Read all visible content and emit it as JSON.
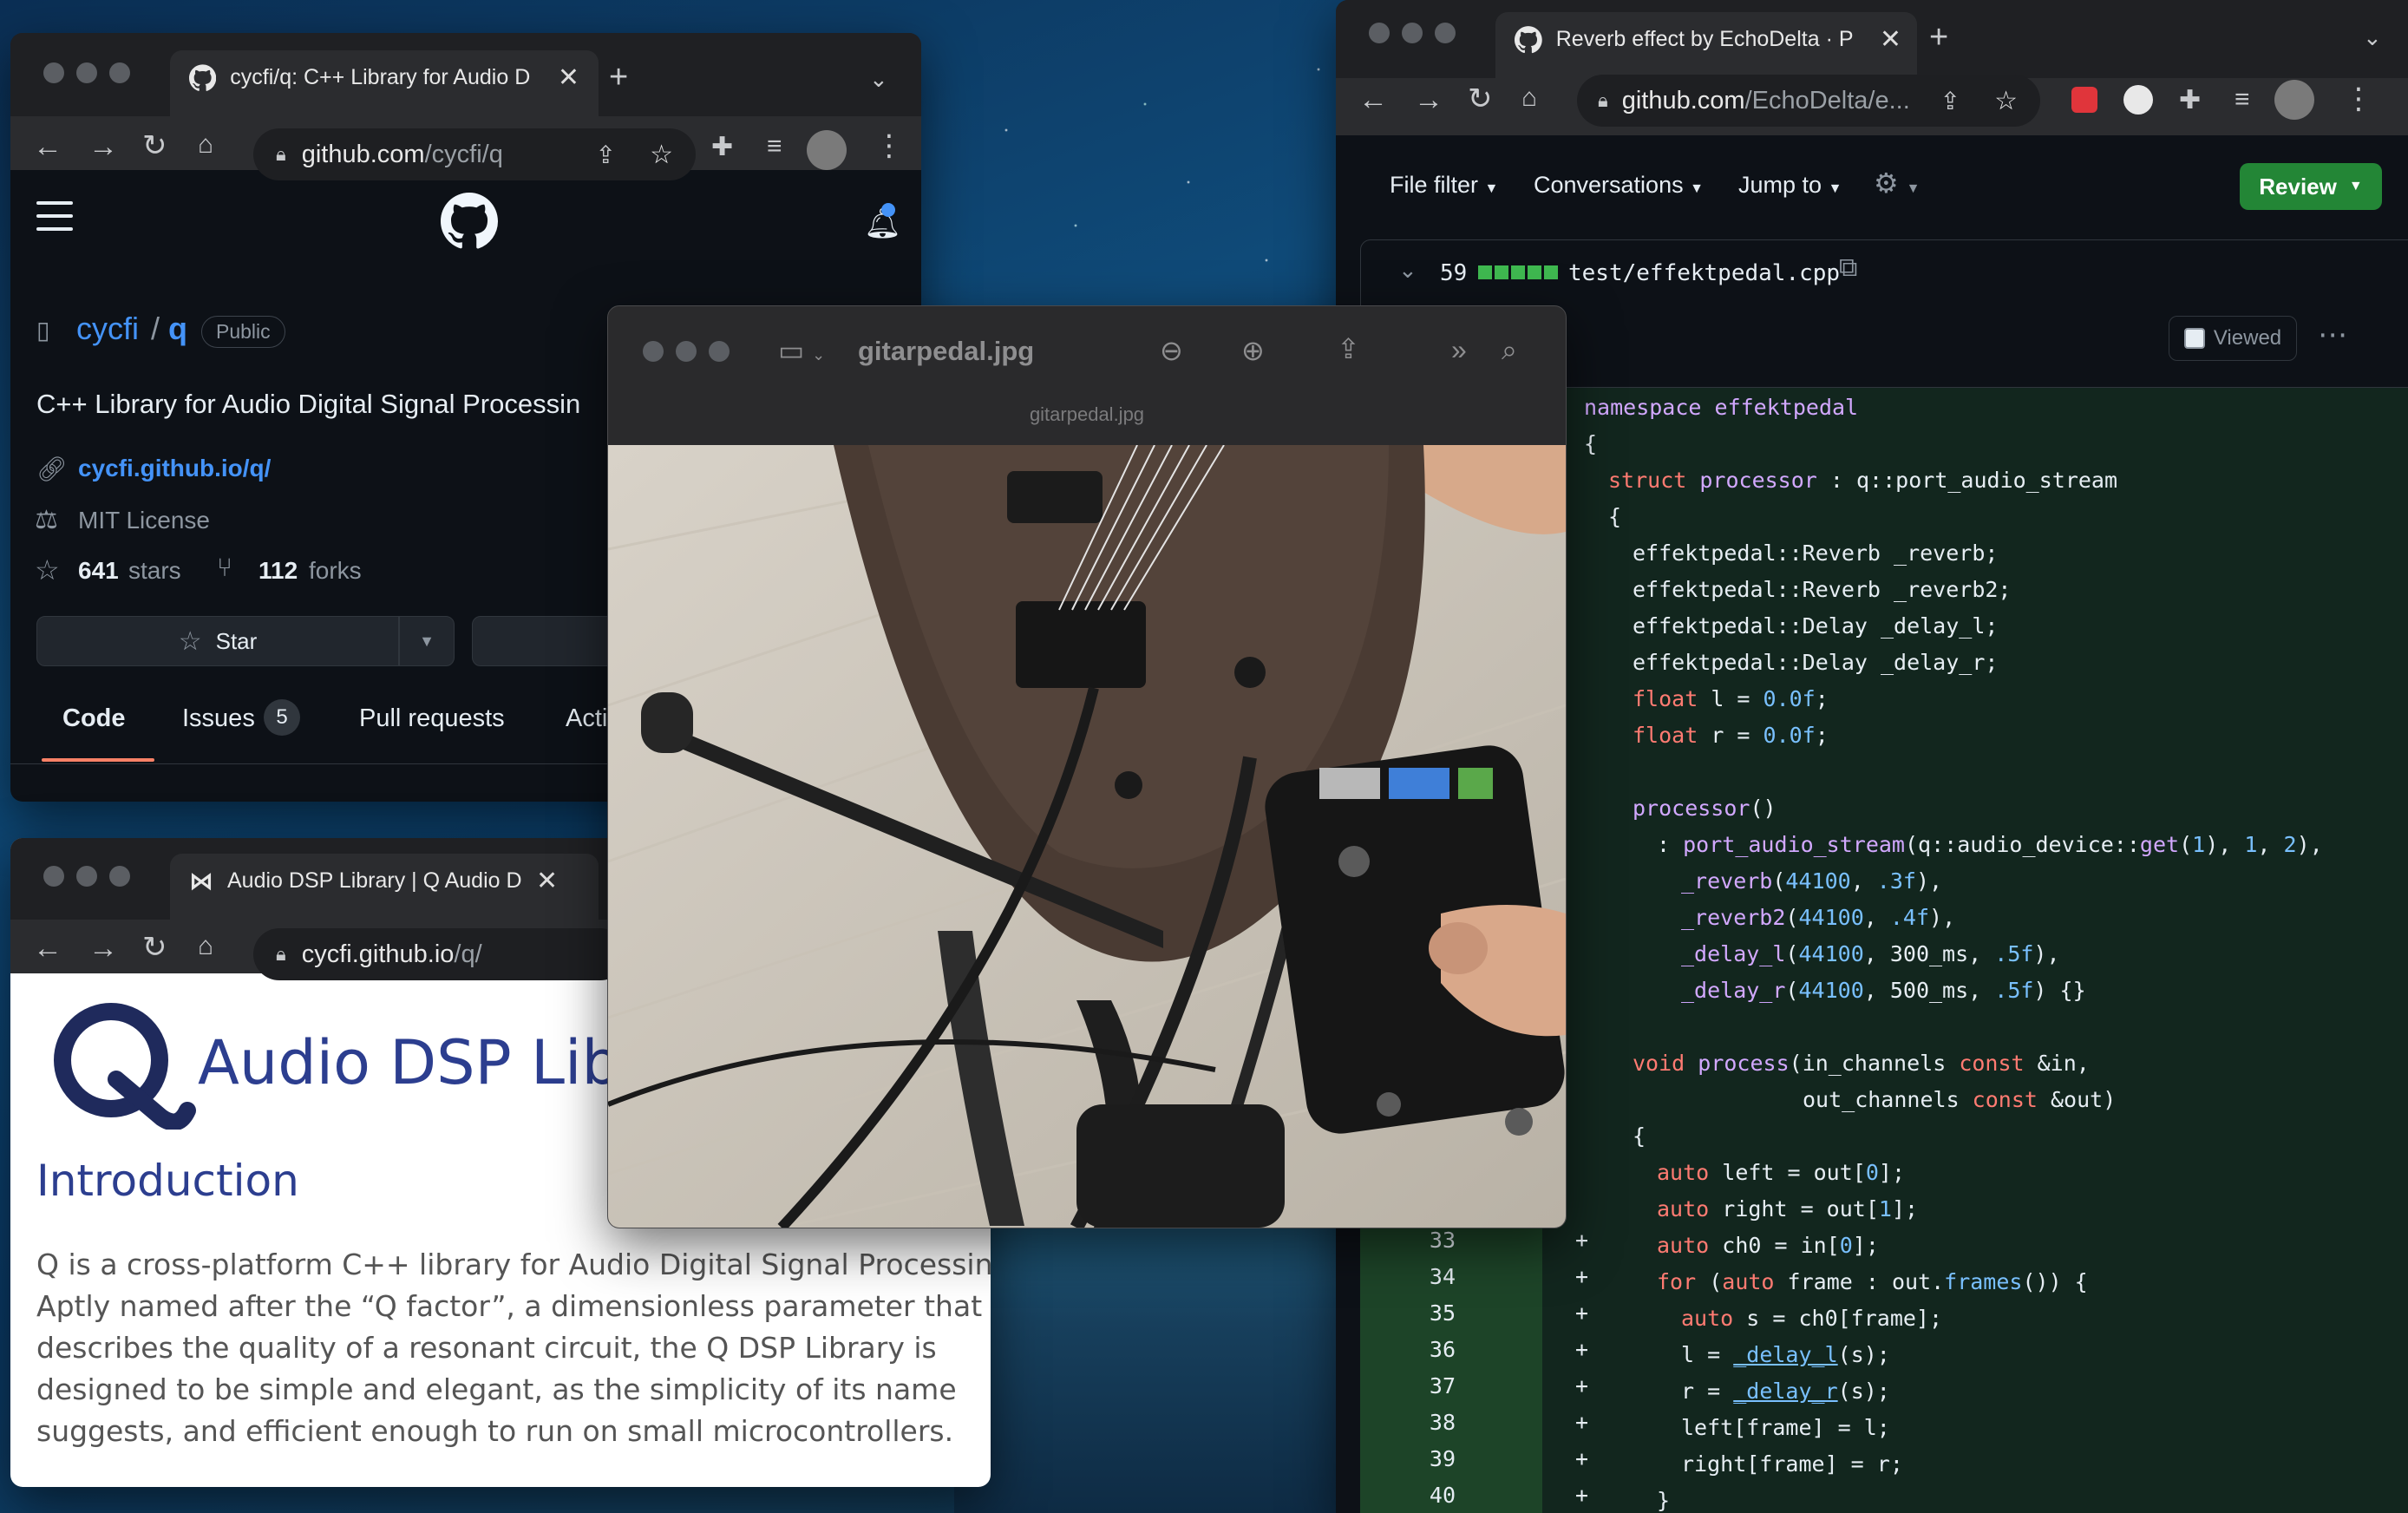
{
  "windows": {
    "github_repo": {
      "tab_title": "cycfi/q: C++ Library for Audio D",
      "url_host": "github.com",
      "url_path": "/cycfi/q",
      "owner": "cycfi",
      "separator": "/",
      "repo": "q",
      "visibility_badge": "Public",
      "description": "C++ Library for Audio Digital Signal Processin",
      "website_link": "cycfi.github.io/q/",
      "license": "MIT License",
      "stars_count": "641",
      "stars_label": "stars",
      "forks_count": "112",
      "forks_label": "forks",
      "star_button": "Star",
      "tabs": [
        {
          "label": "Code"
        },
        {
          "label": "Issues",
          "count": "5"
        },
        {
          "label": "Pull requests"
        },
        {
          "label": "Acti"
        }
      ]
    },
    "docs_site": {
      "tab_title": "Audio DSP Library | Q Audio DS",
      "url_host": "cycfi.github.io",
      "url_path": "/q/",
      "heading": "Audio DSP Libra",
      "intro_heading": "Introduction",
      "intro_lines": [
        "Q is a cross-platform C++ library for Audio Digital Signal Processing.",
        "Aptly named after the “Q factor”, a dimensionless parameter that",
        "describes the quality of a resonant circuit, the Q DSP Library is",
        "designed to be simple and elegant, as the simplicity of its name",
        "suggests, and efficient enough to run on small microcontrollers."
      ]
    },
    "pull_request": {
      "tab_title": "Reverb effect by EchoDelta · P",
      "url_host": "github.com",
      "url_path": "/EchoDelta/e...",
      "toolbar": {
        "file_filter": "File filter",
        "conversations": "Conversations",
        "jump_to": "Jump to",
        "review": "Review"
      },
      "file": {
        "changes": "59",
        "path": "test/effektpedal.cpp",
        "viewed_label": "Viewed"
      },
      "line_numbers": [
        "33",
        "34",
        "35",
        "36",
        "37",
        "38",
        "39",
        "40"
      ],
      "added_marker": "+"
    },
    "preview": {
      "title": "gitarpedal.jpg",
      "subtitle": "gitarpedal.jpg"
    }
  },
  "colors": {
    "github_blue": "#4493f8",
    "review_green": "#238636",
    "diff_added_bg": "#12261e",
    "diff_added_num_bg": "#1d4428",
    "docs_blue": "#2c3e8f"
  }
}
